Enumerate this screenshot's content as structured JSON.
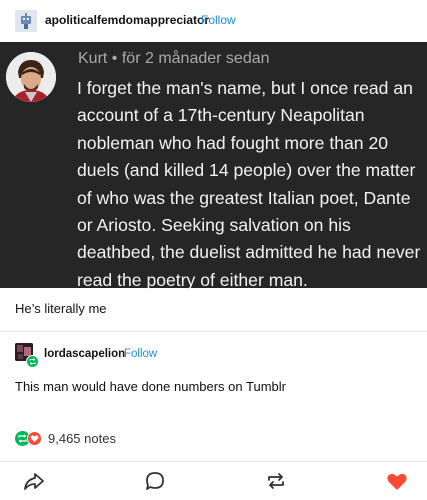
{
  "post": {
    "username": "apoliticalfemdomappreciator",
    "follow_label": "Follow"
  },
  "quote": {
    "author": "Kurt",
    "separator": "•",
    "time": "för 2 månader sedan",
    "lines": [
      "I forget the man's name, but I once read an",
      "account of a 17th-century Neapolitan",
      "nobleman who had fought more than 20",
      "duels (and killed 14 people) over the matter",
      "of who was the greatest Italian poet, Dante",
      "or Ariosto.  Seeking salvation on his",
      "deathbed, the duelist admitted he had never",
      "read the poetry of either man."
    ]
  },
  "caption": "He’s literally me",
  "reblog": {
    "username": "lordascapelion",
    "follow_label": "Follow",
    "text": "This man would have done numbers on Tumblr"
  },
  "notes": {
    "count": "9,465 notes"
  },
  "colors": {
    "follow": "#1d8fe0",
    "reblog_green": "#00b85c",
    "like_red": "#ff4930",
    "quote_bg": "#262626"
  },
  "icons": {
    "share": "share-icon",
    "reply": "reply-icon",
    "reblog": "reblog-icon",
    "like": "heart-icon"
  }
}
